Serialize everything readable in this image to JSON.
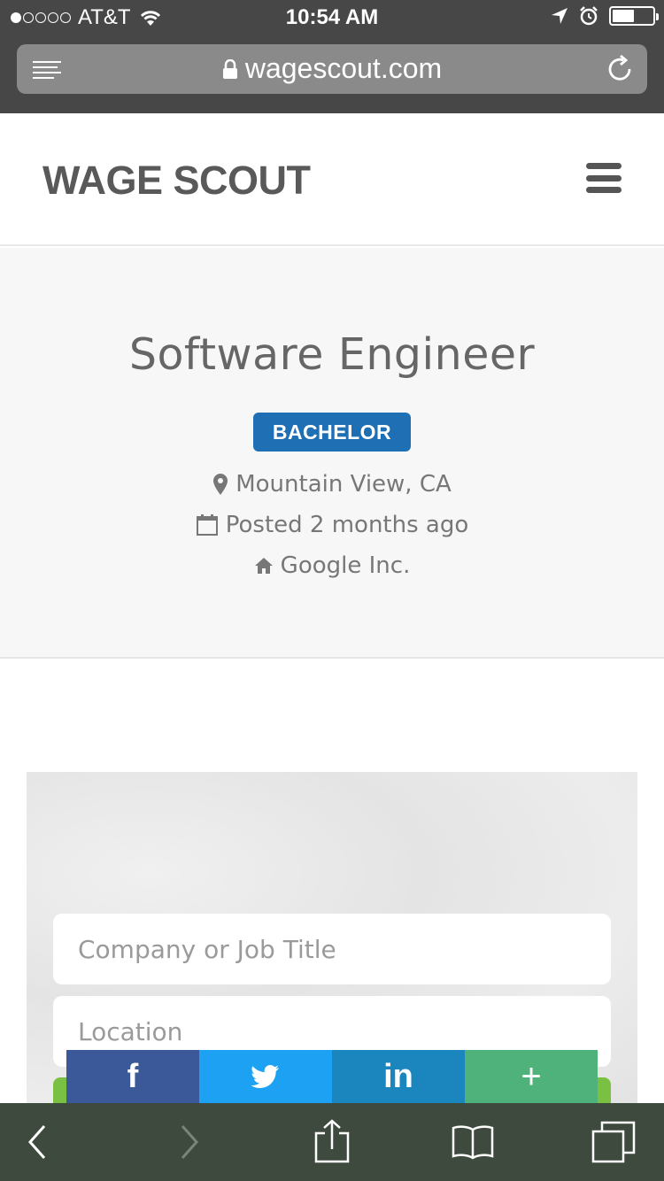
{
  "status_bar": {
    "carrier": "AT&T",
    "time": "10:54 AM",
    "signal_bars_filled": 1,
    "signal_bars_total": 5,
    "battery_level": 0.55
  },
  "browser": {
    "url": "wagescout.com"
  },
  "header": {
    "logo": "WAGE SCOUT"
  },
  "job": {
    "title": "Software Engineer",
    "badge": "BACHELOR",
    "location": "Mountain View, CA",
    "posted": "Posted 2 months ago",
    "company": "Google Inc."
  },
  "search": {
    "company_placeholder": "Company or Job Title",
    "location_placeholder": "Location"
  },
  "share": {
    "facebook": "f",
    "linkedin": "in",
    "more": "+"
  },
  "colors": {
    "badge": "#1f6fb5",
    "facebook": "#3b5998",
    "twitter": "#1da1f2",
    "linkedin": "#1b86bd",
    "more": "#4fb27a",
    "submit": "#7ac143"
  }
}
